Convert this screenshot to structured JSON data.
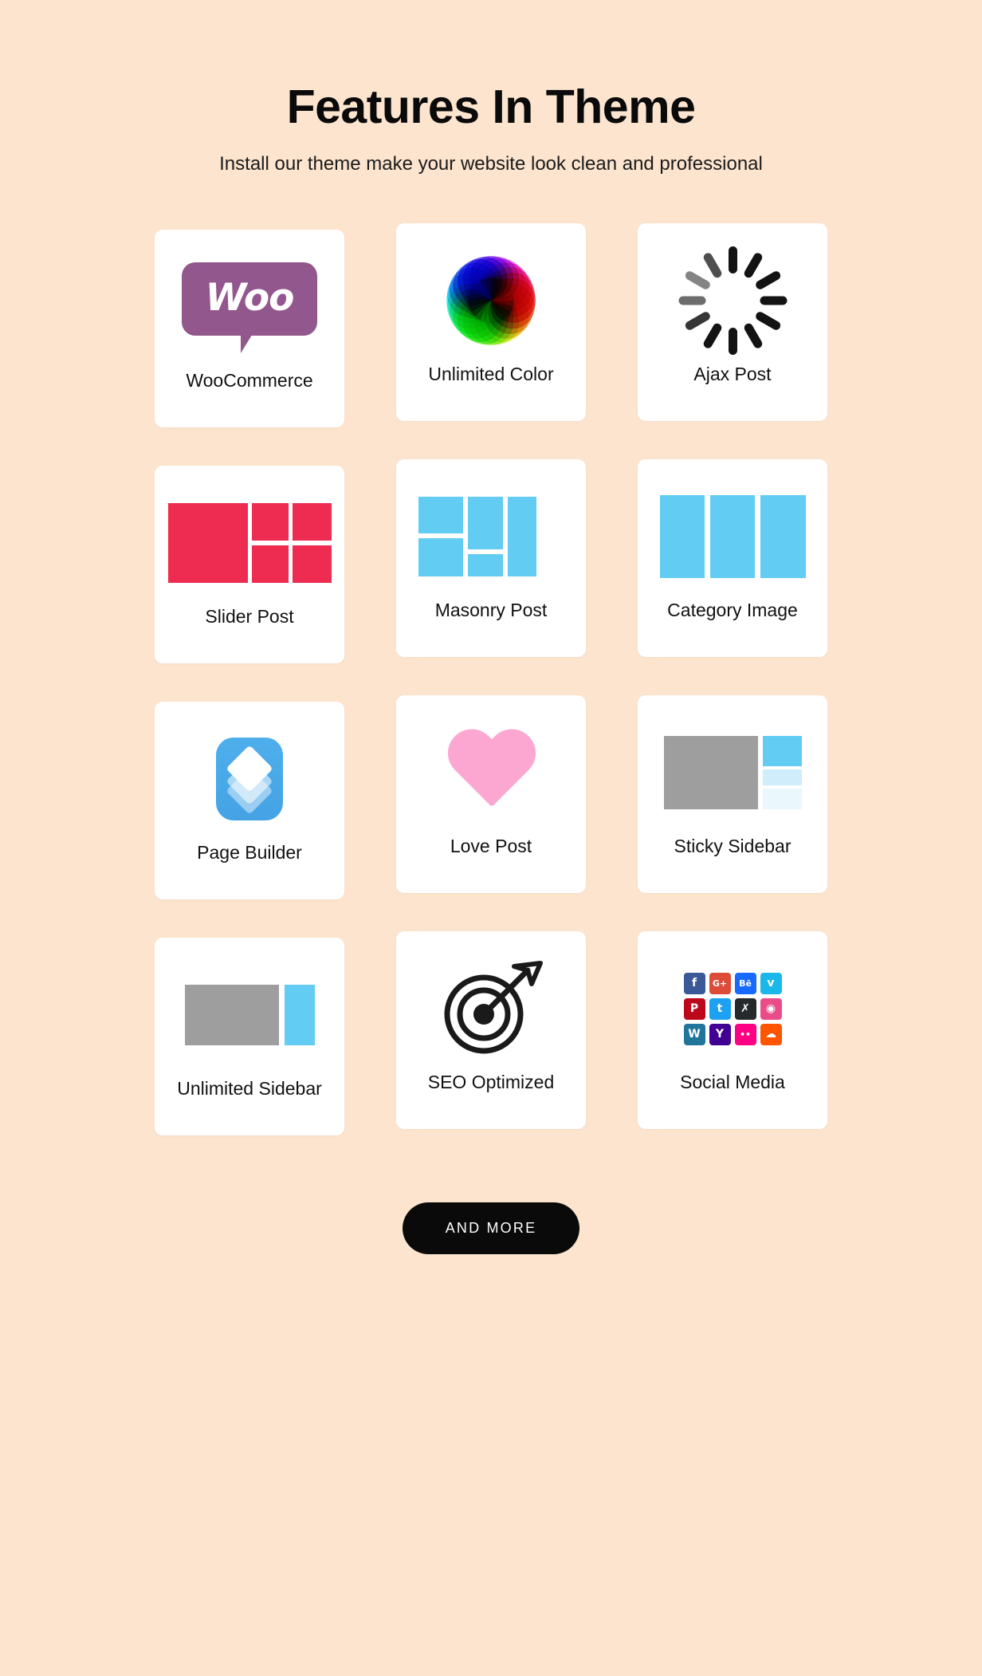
{
  "header": {
    "title": "Features In Theme",
    "subtitle": "Install our theme make your website look clean and professional"
  },
  "colors": {
    "background": "#FCE4CE",
    "card": "#FFFFFF",
    "text": "#111111",
    "woo_purple": "#92578D",
    "slider_red": "#EE2B51",
    "block_blue": "#63CCF3",
    "sidebar_gray": "#9E9E9E",
    "heart_pink": "#FCA7D1",
    "page_builder_blue": "#45A3E5",
    "spinner_dark": "#131313",
    "cta_black": "#0A0A0A"
  },
  "features": [
    {
      "label": "WooCommerce",
      "icon": "woocommerce-icon"
    },
    {
      "label": "Unlimited Color",
      "icon": "color-wheel-icon"
    },
    {
      "label": "Ajax Post",
      "icon": "loading-spinner-icon"
    },
    {
      "label": "Slider Post",
      "icon": "slider-layout-icon"
    },
    {
      "label": "Masonry Post",
      "icon": "masonry-layout-icon"
    },
    {
      "label": "Category Image",
      "icon": "category-columns-icon"
    },
    {
      "label": "Page Builder",
      "icon": "page-builder-icon"
    },
    {
      "label": "Love Post",
      "icon": "heart-icon"
    },
    {
      "label": "Sticky Sidebar",
      "icon": "sticky-sidebar-icon"
    },
    {
      "label": "Unlimited Sidebar",
      "icon": "unlimited-sidebar-icon"
    },
    {
      "label": "SEO Optimized",
      "icon": "target-arrow-icon"
    },
    {
      "label": "Social Media",
      "icon": "social-media-grid-icon"
    }
  ],
  "woocommerce": {
    "wordmark": "Woo"
  },
  "social_media": [
    {
      "name": "facebook",
      "glyph": "f",
      "color": "#3B5998"
    },
    {
      "name": "google-plus",
      "glyph": "G+",
      "color": "#DD4B39"
    },
    {
      "name": "behance",
      "glyph": "Bē",
      "color": "#1769FF"
    },
    {
      "name": "vimeo",
      "glyph": "v",
      "color": "#1AB7EA"
    },
    {
      "name": "pinterest",
      "glyph": "P",
      "color": "#BD081C"
    },
    {
      "name": "twitter",
      "glyph": "t",
      "color": "#1DA1F2"
    },
    {
      "name": "xing",
      "glyph": "✗",
      "color": "#26292C"
    },
    {
      "name": "dribbble",
      "glyph": "◉",
      "color": "#EA4C89"
    },
    {
      "name": "wordpress",
      "glyph": "W",
      "color": "#21759B"
    },
    {
      "name": "yahoo",
      "glyph": "Y",
      "color": "#410093"
    },
    {
      "name": "flickr",
      "glyph": "••",
      "color": "#FF0084"
    },
    {
      "name": "soundcloud",
      "glyph": "☁",
      "color": "#FF5500"
    }
  ],
  "cta": {
    "label": "AND MORE"
  }
}
